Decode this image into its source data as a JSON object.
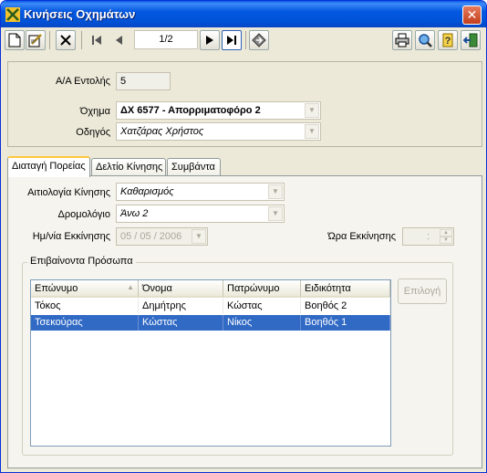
{
  "window": {
    "title": "Κινήσεις Οχημάτων",
    "close_label": "✕"
  },
  "toolbar": {
    "new_icon": "new-doc-icon",
    "edit_icon": "edit-doc-icon",
    "delete_icon": "delete-x-icon",
    "first_icon": "first-record-icon",
    "prev_icon": "prev-record-icon",
    "pager": "1/2",
    "next_icon": "next-record-icon",
    "last_icon": "last-record-icon",
    "goto_icon": "goto-icon",
    "print_icon": "printer-icon",
    "preview_icon": "magnifier-icon",
    "help_icon": "help-icon",
    "exit_icon": "exit-door-icon"
  },
  "header": {
    "order_label": "Α/Α Εντολής",
    "order_value": "5",
    "vehicle_label": "Όχημα",
    "vehicle_value": "ΔΧ 6577 - Απορριματοφόρο 2",
    "driver_label": "Οδηγός",
    "driver_value": "Χατζάρας Χρήστος"
  },
  "tabs": [
    {
      "label": "Διαταγή Πορείας"
    },
    {
      "label": "Δελτίο Κίνησης"
    },
    {
      "label": "Συμβάντα"
    }
  ],
  "movement": {
    "reason_label": "Αιτιολογία Κίνησης",
    "reason_value": "Καθαρισμός",
    "route_label": "Δρομολόγιο",
    "route_value": "Άνω 2",
    "date_label": "Ημ/νία Εκκίνησης",
    "date_value": "05 / 05 / 2006",
    "time_label": "Ώρα Εκκίνησης",
    "time_value": ":"
  },
  "passengers": {
    "legend": "Επιβαίνοντα Πρόσωπα",
    "columns": [
      "Επώνυμο",
      "Όνομα",
      "Πατρώνυμο",
      "Ειδικότητα"
    ],
    "rows": [
      [
        "Τόκος",
        "Δημήτρης",
        "Κώστας",
        "Βοηθός 2"
      ],
      [
        "Τσεκούρας",
        "Κώστας",
        "Νίκος",
        "Βοηθός 1"
      ]
    ],
    "selected_row": 1,
    "pick_label": "Επιλογή"
  },
  "colors": {
    "titlebar": "#0458E0",
    "selection": "#316AC5",
    "window_bg": "#ECE9D8"
  }
}
